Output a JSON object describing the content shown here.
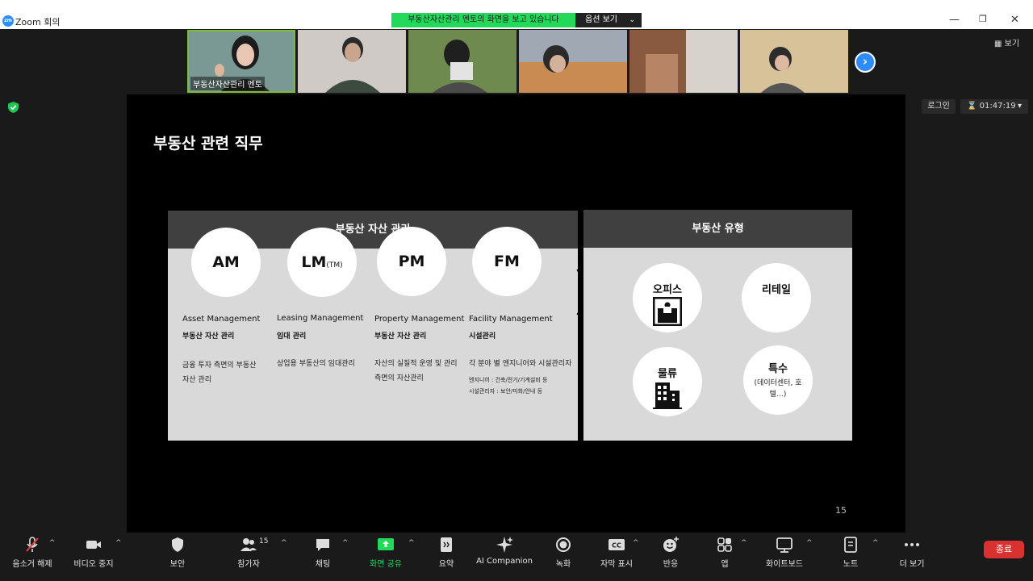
{
  "window": {
    "title": "Zoom 회의",
    "logo_text": "zm"
  },
  "share_banner": {
    "text": "부동산자산관리 멘토의 화면을 보고 있습니다",
    "options_label": "옵션 보기"
  },
  "participants_strip": {
    "active_name": "부동산자산관리 멘토",
    "view_label": "보기"
  },
  "meeting_info": {
    "login_label": "로그인",
    "timer": "01:47:19"
  },
  "slide": {
    "title": "부동산 관련 직무",
    "left_header": "부동산 자산 관리",
    "right_header": "부동산 유형",
    "page_number": "15",
    "roles": [
      {
        "abbr": "AM",
        "suffix": "",
        "title": "Asset Management",
        "sub": "부동산 자산 관리",
        "desc": "금융 투자 측면의 부동산 자산 관리",
        "mini": []
      },
      {
        "abbr": "LM",
        "suffix": "(TM)",
        "title": "Leasing Management",
        "sub": "임대 관리",
        "desc": "상업용 부동산의 임대관리",
        "mini": []
      },
      {
        "abbr": "PM",
        "suffix": "",
        "title": "Property Management",
        "sub": "부동산 자산 관리",
        "desc": "자산의 실질적 운영 및 관리 측면의 자산관리",
        "mini": []
      },
      {
        "abbr": "FM",
        "suffix": "",
        "title": "Facility Management",
        "sub": "시설관리",
        "desc": "각 분야 별 엔지니어와 시설관리자",
        "mini": [
          "엔지니어 : 건축/전기/기계설비 등",
          "시설관리자 : 보안/미화/안내 등"
        ]
      }
    ],
    "types": [
      {
        "label": "오피스",
        "sub": ""
      },
      {
        "label": "리테일",
        "sub": ""
      },
      {
        "label": "물류",
        "sub": ""
      },
      {
        "label": "특수",
        "sub": "(데이터센터, 호텔…)"
      }
    ]
  },
  "toolbar": {
    "items": [
      {
        "label": "음소거 해제",
        "icon": "mic-muted-icon"
      },
      {
        "label": "비디오 중지",
        "icon": "video-icon"
      },
      {
        "label": "보안",
        "icon": "shield-icon"
      },
      {
        "label": "참가자",
        "icon": "participants-icon",
        "count": "15"
      },
      {
        "label": "채팅",
        "icon": "chat-icon"
      },
      {
        "label": "화면 공유",
        "icon": "share-screen-icon"
      },
      {
        "label": "요약",
        "icon": "summary-icon"
      },
      {
        "label": "AI Companion",
        "icon": "ai-companion-icon"
      },
      {
        "label": "녹화",
        "icon": "record-icon"
      },
      {
        "label": "자막 표시",
        "icon": "captions-icon"
      },
      {
        "label": "반응",
        "icon": "reactions-icon"
      },
      {
        "label": "앱",
        "icon": "apps-icon"
      },
      {
        "label": "화이트보드",
        "icon": "whiteboard-icon"
      },
      {
        "label": "노트",
        "icon": "notes-icon"
      },
      {
        "label": "더 보기",
        "icon": "more-icon"
      }
    ],
    "end_label": "종료",
    "share_color": "#23d959",
    "end_color": "#d93030"
  }
}
